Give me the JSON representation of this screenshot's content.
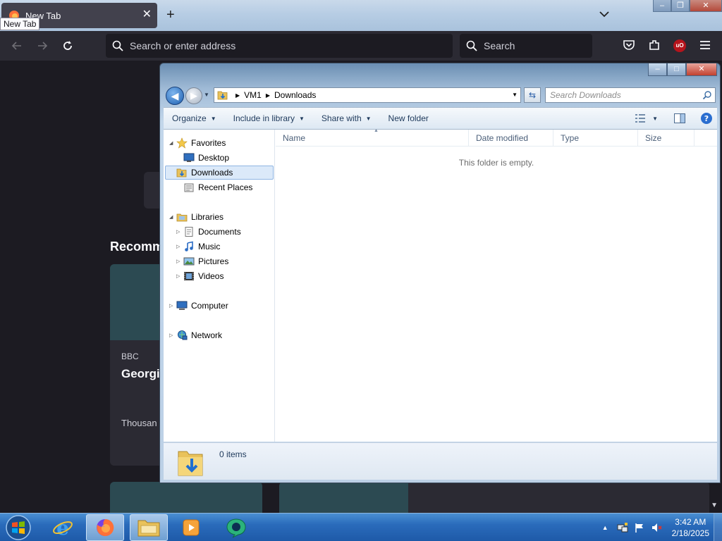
{
  "firefox": {
    "tab": {
      "title": "New Tab",
      "tooltip": "New Tab"
    },
    "urlbar": {
      "placeholder": "Search or enter address"
    },
    "searchbar": {
      "placeholder": "Search"
    },
    "extension_badge": "uO",
    "newtab": {
      "section_title": "Recomm",
      "story": {
        "source": "BBC",
        "title": "Georgi Childre Birth R",
        "description": "Thousan Georgia were sto"
      }
    }
  },
  "explorer": {
    "breadcrumb": [
      "VM1",
      "Downloads"
    ],
    "search_placeholder": "Search Downloads",
    "toolbar": {
      "organize": "Organize",
      "include_in_library": "Include in library",
      "share_with": "Share with",
      "new_folder": "New folder"
    },
    "nav": {
      "favorites": "Favorites",
      "desktop": "Desktop",
      "downloads": "Downloads",
      "recent_places": "Recent Places",
      "libraries": "Libraries",
      "documents": "Documents",
      "music": "Music",
      "pictures": "Pictures",
      "videos": "Videos",
      "computer": "Computer",
      "network": "Network"
    },
    "columns": [
      "Name",
      "Date modified",
      "Type",
      "Size"
    ],
    "empty_message": "This folder is empty.",
    "status": {
      "items": "0 items"
    }
  },
  "taskbar": {
    "time": "3:42 AM",
    "date": "2/18/2025"
  }
}
